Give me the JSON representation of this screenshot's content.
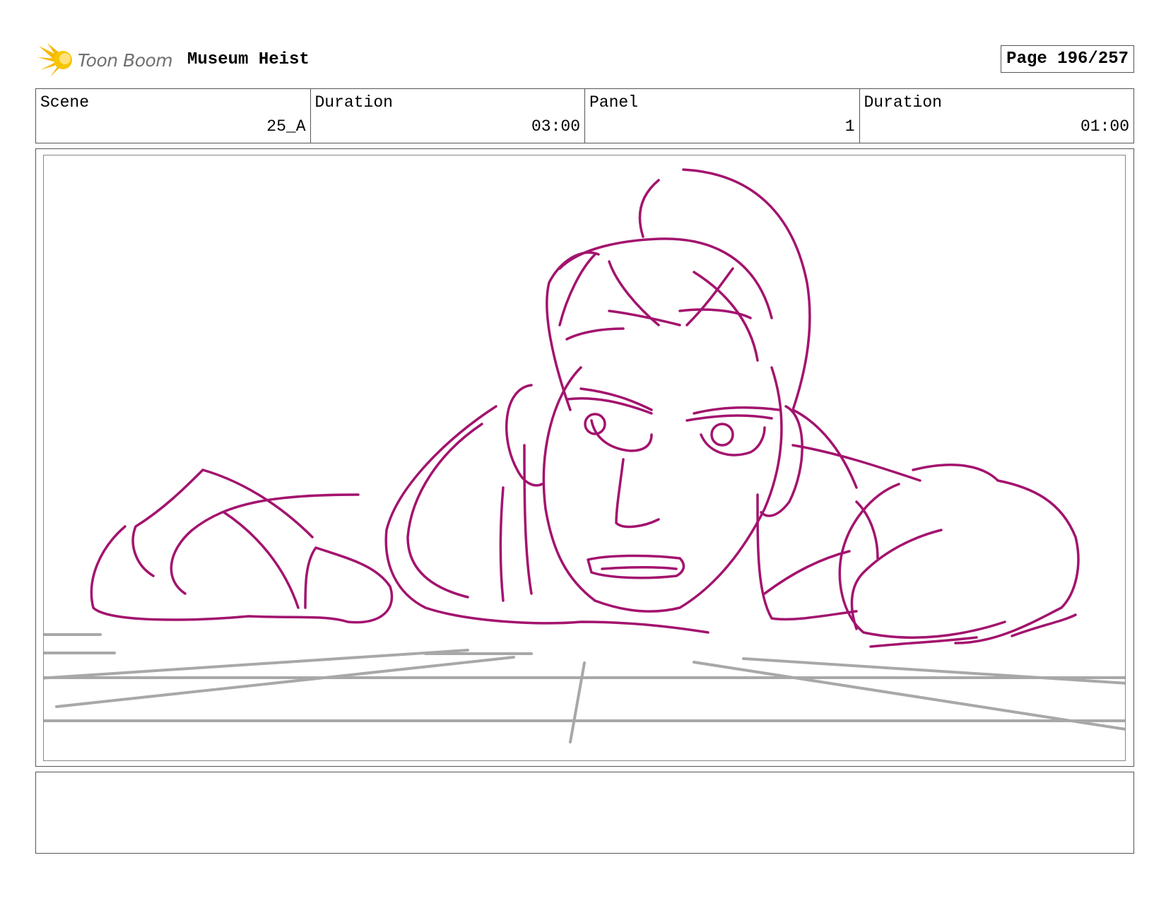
{
  "header": {
    "logo_text": "Toon Boom",
    "project_title": "Museum Heist",
    "page_label": "Page 196/257"
  },
  "info": {
    "scene_label": "Scene",
    "scene_value": "25_A",
    "scene_duration_label": "Duration",
    "scene_duration_value": "03:00",
    "panel_label": "Panel",
    "panel_value": "1",
    "panel_duration_label": "Duration",
    "panel_duration_value": "01:00"
  },
  "colors": {
    "sketch": "#a3136e",
    "guide": "#a8a8a8",
    "logo_yellow": "#f5b800"
  },
  "panel": {
    "image": "storyboard-sketch",
    "notes": ""
  }
}
